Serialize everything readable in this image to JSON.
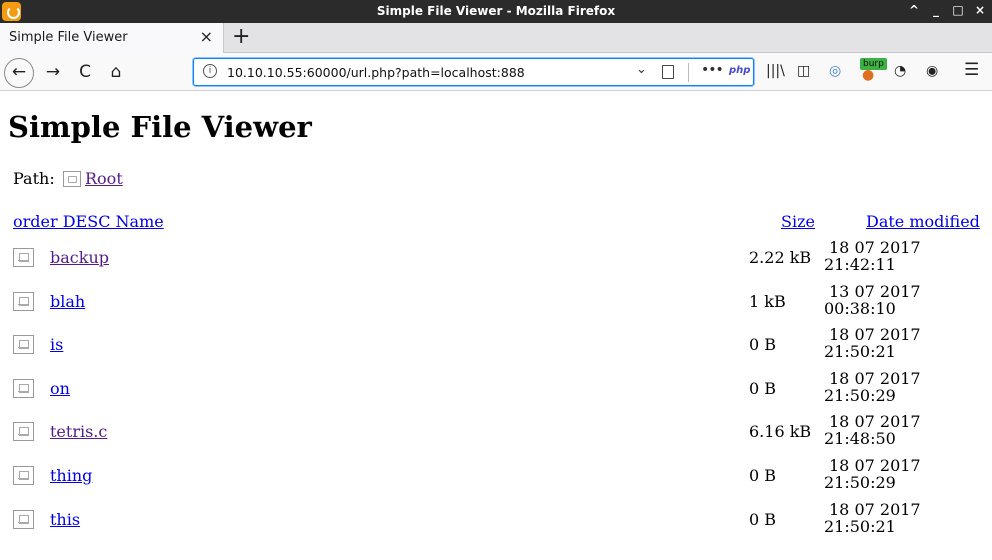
{
  "window": {
    "title": "Simple File Viewer - Mozilla Firefox",
    "controls": [
      "^",
      "_",
      "□",
      "×"
    ]
  },
  "tab": {
    "label": "Simple File Viewer",
    "close": "×",
    "new_tab": "+"
  },
  "nav": {
    "back": "←",
    "forward": "→",
    "reload": "C",
    "home": "⌂",
    "url": "10.10.10.55:60000/url.php?path=localhost:888",
    "php_badge": "php",
    "more": "•••",
    "burp_badge": "burp",
    "menu": "☰"
  },
  "page": {
    "title": "Simple File Viewer",
    "path_label": "Path:",
    "root_link": "Root",
    "headers": {
      "name": "order DESC Name",
      "size": "Size",
      "date": "Date modified"
    },
    "files": [
      {
        "name": "backup",
        "size": "2.22 kB",
        "date": "18 07 2017",
        "time": "21:42:11",
        "visited": true
      },
      {
        "name": "blah",
        "size": "1 kB",
        "date": "13 07 2017",
        "time": "00:38:10",
        "visited": false
      },
      {
        "name": "is",
        "size": "0 B",
        "date": "18 07 2017",
        "time": "21:50:21",
        "visited": false
      },
      {
        "name": "on",
        "size": "0 B",
        "date": "18 07 2017",
        "time": "21:50:29",
        "visited": false
      },
      {
        "name": "tetris.c",
        "size": "6.16 kB",
        "date": "18 07 2017",
        "time": "21:48:50",
        "visited": true
      },
      {
        "name": "thing",
        "size": "0 B",
        "date": "18 07 2017",
        "time": "21:50:29",
        "visited": false
      },
      {
        "name": "this",
        "size": "0 B",
        "date": "18 07 2017",
        "time": "21:50:21",
        "visited": false
      }
    ]
  },
  "colors": {
    "link": "#0000ee",
    "visited": "#551a8b",
    "titlebar": "#2b2b2b",
    "url_focus": "#0a84ff"
  }
}
